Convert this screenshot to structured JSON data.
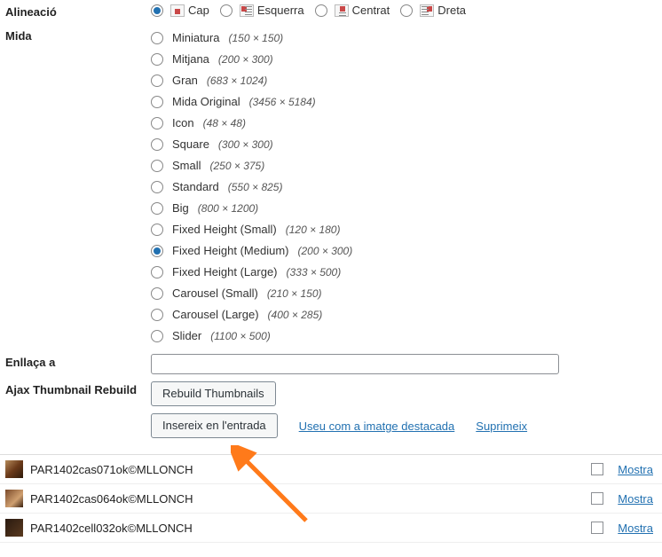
{
  "labels": {
    "alignment": "Alineació",
    "size": "Mida",
    "link_to": "Enllaça a",
    "ajax_rebuild": "Ajax Thumbnail Rebuild"
  },
  "alignment": {
    "options": [
      {
        "value": "none",
        "label": "Cap",
        "icon": "align-cap"
      },
      {
        "value": "left",
        "label": "Esquerra",
        "icon": "align-left"
      },
      {
        "value": "center",
        "label": "Centrat",
        "icon": "align-center"
      },
      {
        "value": "right",
        "label": "Dreta",
        "icon": "align-right"
      }
    ],
    "selected": "none"
  },
  "sizes": {
    "options": [
      {
        "value": "thumbnail",
        "label": "Miniatura",
        "dim": "(150 × 150)"
      },
      {
        "value": "medium",
        "label": "Mitjana",
        "dim": "(200 × 300)"
      },
      {
        "value": "large",
        "label": "Gran",
        "dim": "(683 × 1024)"
      },
      {
        "value": "full",
        "label": "Mida Original",
        "dim": "(3456 × 5184)"
      },
      {
        "value": "icon",
        "label": "Icon",
        "dim": "(48 × 48)"
      },
      {
        "value": "square",
        "label": "Square",
        "dim": "(300 × 300)"
      },
      {
        "value": "small",
        "label": "Small",
        "dim": "(250 × 375)"
      },
      {
        "value": "standard",
        "label": "Standard",
        "dim": "(550 × 825)"
      },
      {
        "value": "big",
        "label": "Big",
        "dim": "(800 × 1200)"
      },
      {
        "value": "fh-small",
        "label": "Fixed Height (Small)",
        "dim": "(120 × 180)"
      },
      {
        "value": "fh-medium",
        "label": "Fixed Height (Medium)",
        "dim": "(200 × 300)"
      },
      {
        "value": "fh-large",
        "label": "Fixed Height (Large)",
        "dim": "(333 × 500)"
      },
      {
        "value": "carousel-s",
        "label": "Carousel (Small)",
        "dim": "(210 × 150)"
      },
      {
        "value": "carousel-l",
        "label": "Carousel (Large)",
        "dim": "(400 × 285)"
      },
      {
        "value": "slider",
        "label": "Slider",
        "dim": "(1100 × 500)"
      }
    ],
    "selected": "fh-medium"
  },
  "link_to": {
    "value": ""
  },
  "buttons": {
    "rebuild": "Rebuild Thumbnails",
    "insert": "Insereix en l'entrada"
  },
  "links": {
    "featured": "Useu com a imatge destacada",
    "delete": "Suprimeix",
    "show": "Mostra"
  },
  "media": {
    "rows": [
      {
        "title": "PAR1402cas071ok©MLLONCH"
      },
      {
        "title": "PAR1402cas064ok©MLLONCH"
      },
      {
        "title": "PAR1402cell032ok©MLLONCH"
      }
    ]
  }
}
